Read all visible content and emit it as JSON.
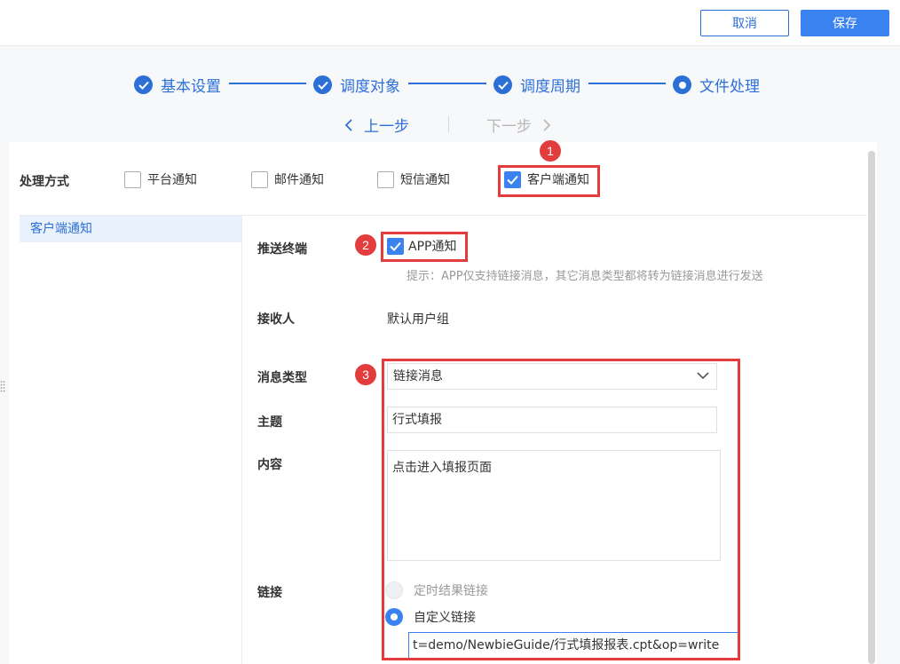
{
  "toolbar": {
    "cancel_label": "取消",
    "save_label": "保存"
  },
  "steps": [
    {
      "label": "基本设置",
      "state": "done"
    },
    {
      "label": "调度对象",
      "state": "done"
    },
    {
      "label": "调度周期",
      "state": "done"
    },
    {
      "label": "文件处理",
      "state": "current"
    }
  ],
  "step_nav": {
    "prev_label": "上一步",
    "next_label": "下一步"
  },
  "processing": {
    "label": "处理方式",
    "options": [
      {
        "label": "平台通知",
        "checked": false
      },
      {
        "label": "邮件通知",
        "checked": false
      },
      {
        "label": "短信通知",
        "checked": false
      },
      {
        "label": "客户端通知",
        "checked": true
      }
    ]
  },
  "sidebar": {
    "items": [
      {
        "label": "客户端通知",
        "selected": true
      }
    ]
  },
  "form": {
    "push_terminal": {
      "label": "推送终端",
      "option_label": "APP通知",
      "checked": true,
      "hint": "提示：APP仅支持链接消息，其它消息类型都将转为链接消息进行发送"
    },
    "receiver": {
      "label": "接收人",
      "value": "默认用户组"
    },
    "message_type": {
      "label": "消息类型",
      "value": "链接消息"
    },
    "subject": {
      "label": "主题",
      "value": "行式填报"
    },
    "content": {
      "label": "内容",
      "value": "点击进入填报页面"
    },
    "link": {
      "label": "链接",
      "options": [
        {
          "label": "定时结果链接",
          "selected": false,
          "disabled": true
        },
        {
          "label": "自定义链接",
          "selected": true,
          "disabled": false
        }
      ],
      "url": "t=demo/NewbieGuide/行式填报报表.cpt&op=write"
    }
  },
  "annotations": [
    "1",
    "2",
    "3"
  ],
  "colors": {
    "accent": "#3a82f0",
    "primary_text": "#2c6fd6",
    "annotation": "#e23c3c"
  }
}
